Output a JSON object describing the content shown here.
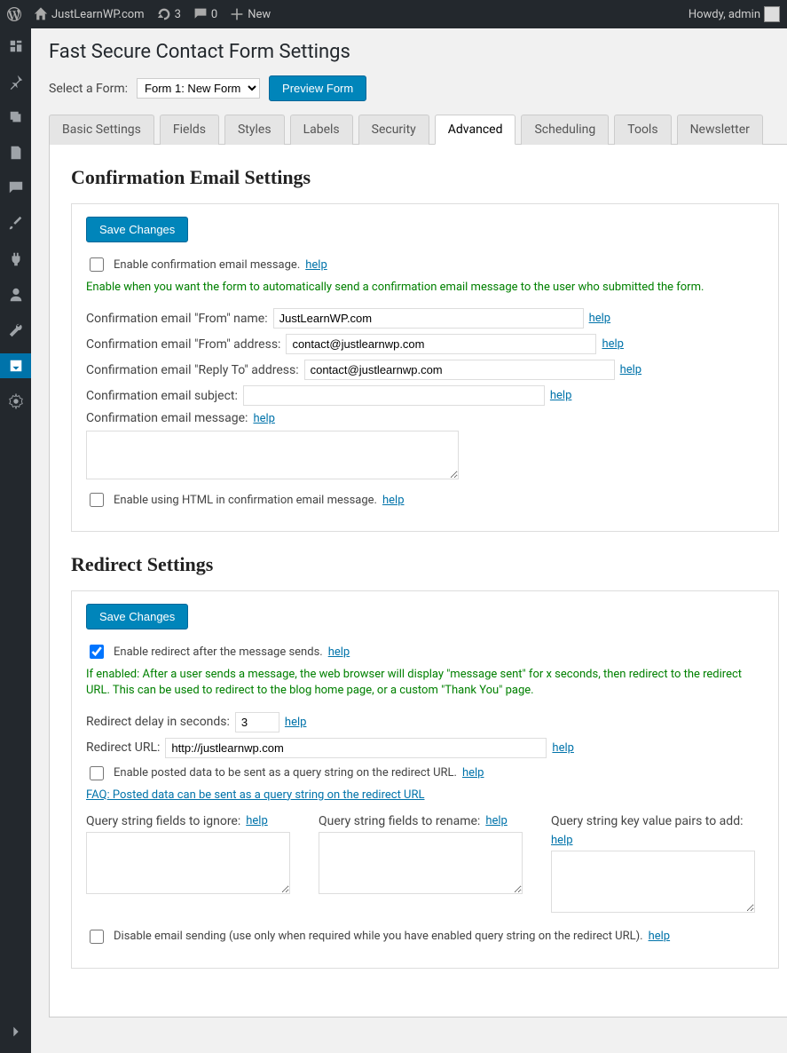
{
  "adminbar": {
    "site_name": "JustLearnWP.com",
    "updates": "3",
    "comments": "0",
    "new_label": "New",
    "howdy": "Howdy, admin"
  },
  "page_title": "Fast Secure Contact Form Settings",
  "select_label": "Select a Form:",
  "select_value": "Form 1: New Form",
  "preview_btn": "Preview Form",
  "tabs": [
    "Basic Settings",
    "Fields",
    "Styles",
    "Labels",
    "Security",
    "Advanced",
    "Scheduling",
    "Tools",
    "Newsletter"
  ],
  "help": "help",
  "conf": {
    "heading": "Confirmation Email Settings",
    "save": "Save Changes",
    "enable_msg": "Enable confirmation email message.",
    "enable_hint": "Enable when you want the form to automatically send a confirmation email message to the user who submitted the form.",
    "from_name_lbl": "Confirmation email \"From\" name:",
    "from_name_val": "JustLearnWP.com",
    "from_addr_lbl": "Confirmation email \"From\" address:",
    "from_addr_val": "contact@justlearnwp.com",
    "reply_lbl": "Confirmation email \"Reply To\" address:",
    "reply_val": "contact@justlearnwp.com",
    "subject_lbl": "Confirmation email subject:",
    "subject_val": "",
    "msg_lbl": "Confirmation email message:",
    "html_chk": "Enable using HTML in confirmation email message."
  },
  "redir": {
    "heading": "Redirect Settings",
    "save": "Save Changes",
    "enable_msg": "Enable redirect after the message sends.",
    "enable_hint": "If enabled: After a user sends a message, the web browser will display \"message sent\" for x seconds, then redirect to the redirect URL. This can be used to redirect to the blog home page, or a custom \"Thank You\" page.",
    "delay_lbl": "Redirect delay in seconds:",
    "delay_val": "3",
    "url_lbl": "Redirect URL:",
    "url_val": "http://justlearnwp.com",
    "posted_chk": "Enable posted data to be sent as a query string on the redirect URL.",
    "faq": "FAQ: Posted data can be sent as a query string on the redirect URL",
    "q_ignore": "Query string fields to ignore:",
    "q_rename": "Query string fields to rename:",
    "q_add": "Query string key value pairs to add:",
    "disable_email": "Disable email sending (use only when required while you have enabled query string on the redirect URL)."
  }
}
